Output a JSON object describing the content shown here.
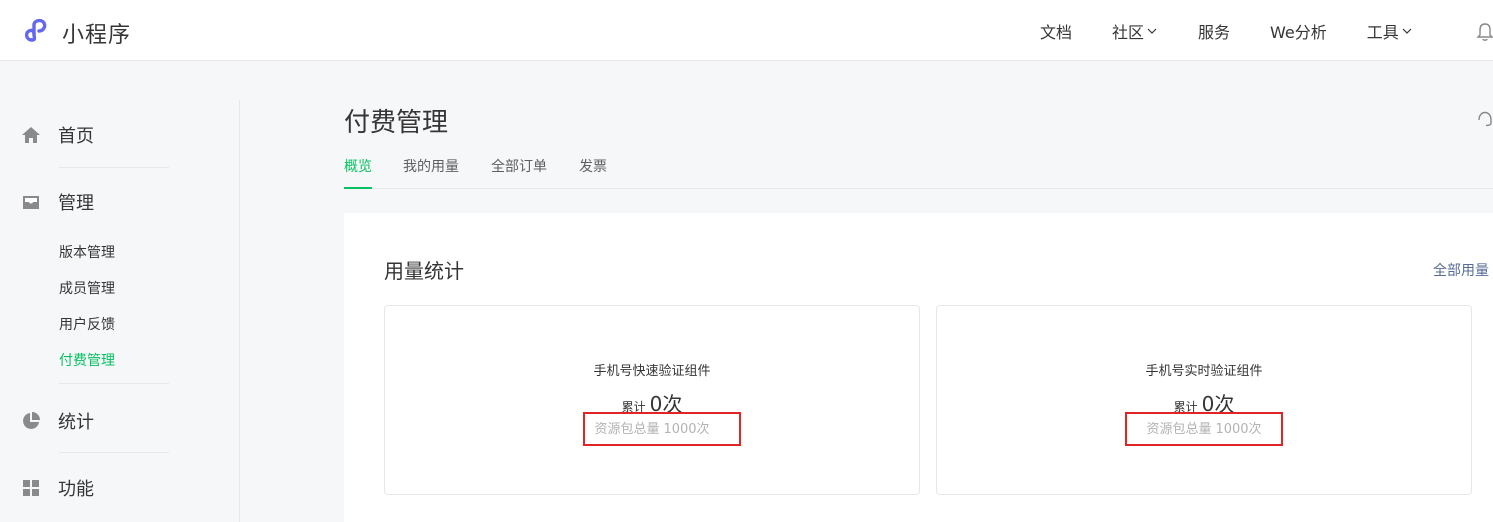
{
  "app": {
    "title": "小程序",
    "logo_icon": "mini-program-logo-icon",
    "brand_color": "#6467f0"
  },
  "topnav": {
    "items": [
      {
        "label": "文档",
        "has_dropdown": false
      },
      {
        "label": "社区",
        "has_dropdown": true
      },
      {
        "label": "服务",
        "has_dropdown": false
      },
      {
        "label": "We分析",
        "has_dropdown": false
      },
      {
        "label": "工具",
        "has_dropdown": true
      }
    ],
    "bell_icon": "bell-icon"
  },
  "sidebar": {
    "home": {
      "label": "首页",
      "icon": "home-icon"
    },
    "manage": {
      "label": "管理",
      "icon": "inbox-icon",
      "items": [
        "版本管理",
        "成员管理",
        "用户反馈",
        "付费管理"
      ],
      "active_index": 3
    },
    "stats": {
      "label": "统计",
      "icon": "pie-chart-icon"
    },
    "features": {
      "label": "功能",
      "icon": "grid-icon"
    }
  },
  "main": {
    "title": "付费管理",
    "tabs": [
      "概览",
      "我的用量",
      "全部订单",
      "发票"
    ],
    "active_tab": 0,
    "section_title": "用量统计",
    "all_usage_link": "全部用量",
    "cards": [
      {
        "name": "手机号快速验证组件",
        "cumulative_label": "累计",
        "cumulative_value": "0次",
        "total_label": "资源包总量",
        "total_value": "1000次",
        "highlighted": true
      },
      {
        "name": "手机号实时验证组件",
        "cumulative_label": "累计",
        "cumulative_value": "0次",
        "total_label": "资源包总量",
        "total_value": "1000次",
        "highlighted": true
      }
    ]
  },
  "colors": {
    "accent": "#07c160",
    "link": "#576b95",
    "highlight_box": "#e12424"
  }
}
